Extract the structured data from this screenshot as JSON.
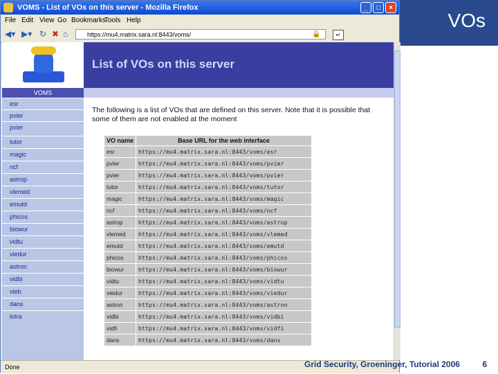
{
  "slide": {
    "title": "VOs",
    "footer": "Grid Security, Groeninger, Tutorial 2006",
    "page_number": "6",
    "band_color": "#2a4a8f"
  },
  "browser": {
    "window_title": "VOMS - List of VOs on this server - Mozilla Firefox",
    "menu": [
      "File",
      "Edit",
      "View",
      "Go",
      "Bookmarks",
      "Tools",
      "Help"
    ],
    "url": "https://mu4.matrix.sara.nl:8443/voms/",
    "status": "Done",
    "window_buttons": [
      "minimize-icon",
      "maximize-icon",
      "close-icon"
    ]
  },
  "page": {
    "header_title": "List of VOs on this server",
    "side_label": "VOMS",
    "sidebar_items": [
      "esr",
      "pvier",
      "pvier",
      "tutor",
      "magic",
      "ncf",
      "astrop",
      "vlemed",
      "emutd",
      "phicos",
      "biowur",
      "vidtu",
      "viedur",
      "astron",
      "vidbi",
      "vieb",
      "dans",
      "lotra"
    ],
    "intro": "The following is a list of VOs that are defined on this server. Note that it is possible that some of them are not enabled at the moment",
    "table": {
      "headers": [
        "VO name",
        "Base URL for the web interface"
      ],
      "rows": [
        [
          "esr",
          "https://mu4.matrix.sara.nl:8443/voms/esr"
        ],
        [
          "pvier",
          "https://mu4.matrix.sara.nl:8443/voms/pvier"
        ],
        [
          "pvier",
          "https://mu4.matrix.sara.nl:8443/voms/pvier"
        ],
        [
          "tutor",
          "https://mu4.matrix.sara.nl:8443/voms/tutor"
        ],
        [
          "magic",
          "https://mu4.matrix.sara.nl:8443/voms/magic"
        ],
        [
          "ncf",
          "https://mu4.matrix.sara.nl:8443/voms/ncf"
        ],
        [
          "astrop",
          "https://mu4.matrix.sara.nl:8443/voms/astrop"
        ],
        [
          "vlemed",
          "https://mu4.matrix.sara.nl:8443/voms/vlemed"
        ],
        [
          "emutd",
          "https://mu4.matrix.sara.nl:8443/voms/emutd"
        ],
        [
          "phicos",
          "https://mu4.matrix.sara.nl:8443/voms/phicos"
        ],
        [
          "biowur",
          "https://mu4.matrix.sara.nl:8443/voms/biowur"
        ],
        [
          "vidtu",
          "https://mu4.matrix.sara.nl:8443/voms/vidtu"
        ],
        [
          "viedur",
          "https://mu4.matrix.sara.nl:8443/voms/viedur"
        ],
        [
          "astron",
          "https://mu4.matrix.sara.nl:8443/voms/astron"
        ],
        [
          "vidbi",
          "https://mu4.matrix.sara.nl:8443/voms/vidbi"
        ],
        [
          "vidfi",
          "https://mu4.matrix.sara.nl:8443/voms/vidfi"
        ],
        [
          "dans",
          "https://mu4.matrix.sara.nl:8443/voms/dans"
        ]
      ]
    }
  }
}
